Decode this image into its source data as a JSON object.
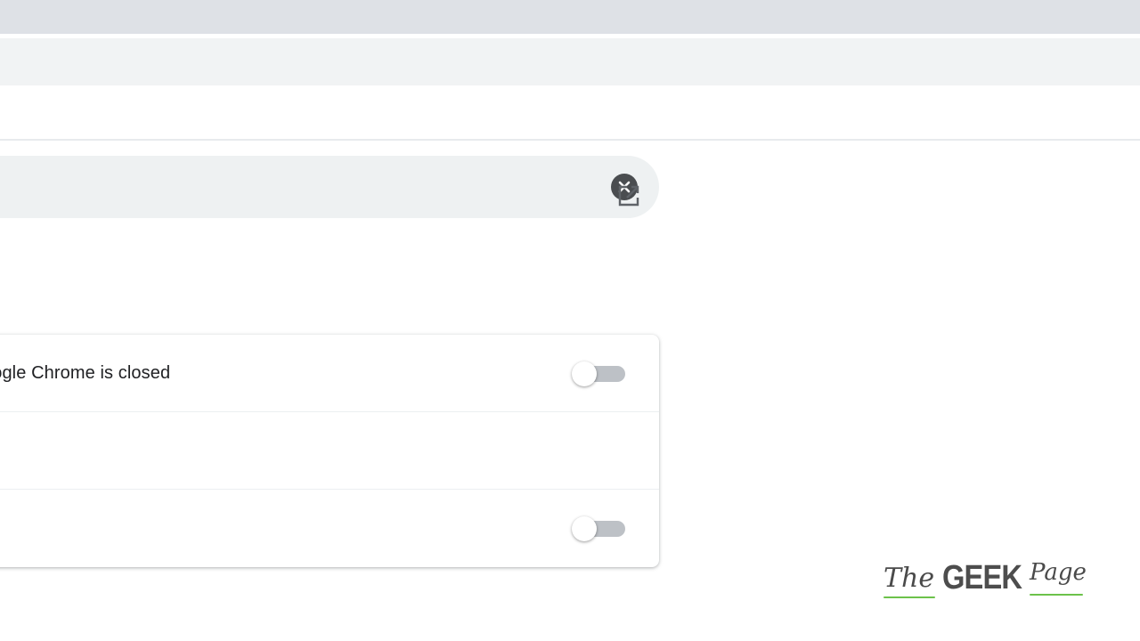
{
  "settings": {
    "rows": [
      {
        "label": "oogle Chrome is closed",
        "toggle_on": false
      },
      {
        "label": "",
        "toggle_on": false
      },
      {
        "label": "",
        "action_icon": "external-link-icon"
      }
    ]
  },
  "search": {
    "clear_icon": "clear-icon"
  },
  "watermark": {
    "the": "The",
    "geek": "GEEK",
    "page": "Page"
  },
  "colors": {
    "tabstrip": "#dee1e6",
    "toolbar": "#f1f3f4",
    "search_background": "#eef1f2",
    "toggle_track_off": "#bdc1c6",
    "watermark_accent": "#6cc24a"
  }
}
